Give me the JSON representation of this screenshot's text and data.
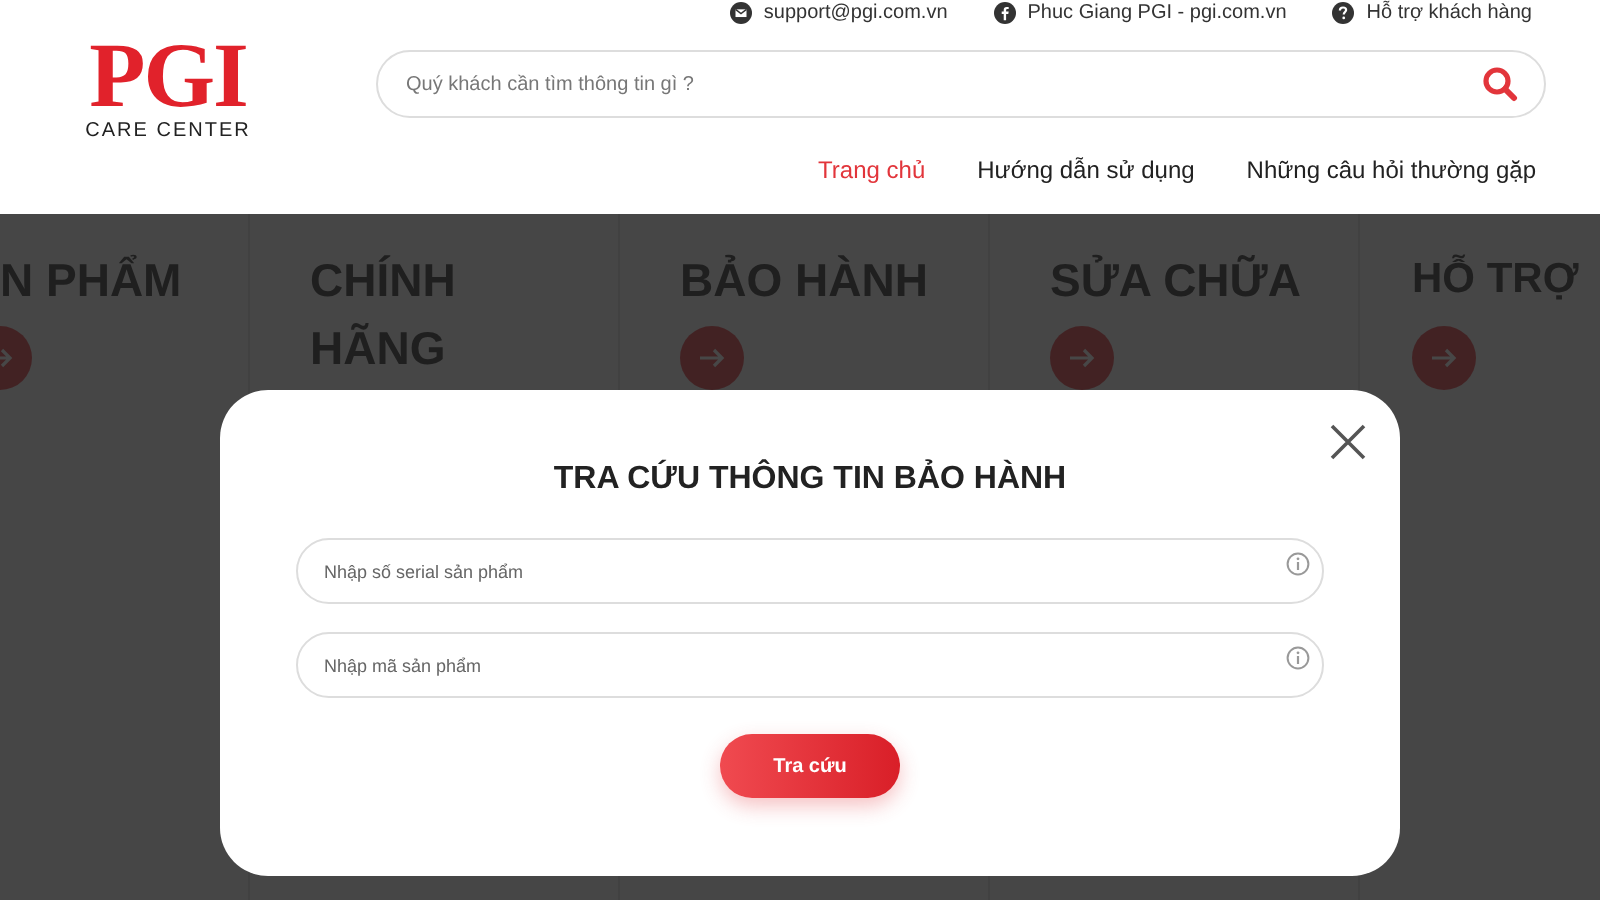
{
  "topbar": [
    {
      "kind": "mail",
      "text": "support@pgi.com.vn"
    },
    {
      "kind": "facebook",
      "text": "Phuc Giang PGI - pgi.com.vn"
    },
    {
      "kind": "help",
      "text": "Hỗ trợ khách hàng"
    }
  ],
  "logo": {
    "mark": "PGI",
    "subtitle": "CARE CENTER"
  },
  "search": {
    "placeholder": "Quý khách cần tìm thông tin gì ?"
  },
  "nav": [
    {
      "label": "Trang chủ",
      "selected": true
    },
    {
      "label": "Hướng dẫn sử dụng",
      "selected": false
    },
    {
      "label": "Những câu hỏi thường gặp",
      "selected": false
    }
  ],
  "cards": [
    {
      "lines": [
        "N PHẨM"
      ]
    },
    {
      "lines": [
        "CHÍNH",
        "HÃNG"
      ]
    },
    {
      "lines": [
        "BẢO HÀNH"
      ]
    },
    {
      "lines": [
        "SỬA CHỮA"
      ]
    },
    {
      "lines": [
        "HỖ TRỢ"
      ]
    }
  ],
  "modal": {
    "title": "TRA CỨU THÔNG TIN BẢO HÀNH",
    "fields": [
      {
        "placeholder": "Nhập số serial sản phẩm"
      },
      {
        "placeholder": "Nhập mã sản phẩm"
      }
    ],
    "button": "Tra cứu"
  }
}
